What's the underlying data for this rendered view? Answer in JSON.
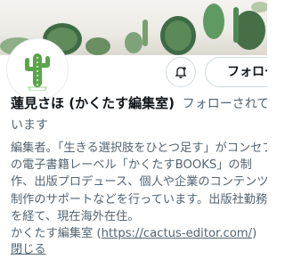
{
  "profile": {
    "display_name": "蓮見さほ (かくたす編集室)",
    "follow_status": "フォローされています",
    "follow_status_tail": "います"
  },
  "actions": {
    "follow_label": "フォロー中"
  },
  "bio": {
    "lines": [
      "編集者。「生きる選択肢をひとつ足す」がコンセプト",
      "の電子書籍レーベル「かくたすBOOKS」の制",
      "作、出版プロデュース、個人や企業のコンテンツ",
      "制作のサポートなどを行っています。出版社勤務",
      "を経て、現在海外在住。"
    ],
    "link_prefix": "かくたす編集室 (",
    "link_text": "https://cactus-editor.com/",
    "link_suffix": ")",
    "collapse_label": "閉じる"
  },
  "colors": {
    "text_primary": "#0f1419",
    "text_secondary": "#536471",
    "border": "#cfd9de",
    "cactus_green": "#5aa54a"
  },
  "icons": {
    "avatar": "cactus-icon",
    "notify": "bell-plus-icon"
  }
}
